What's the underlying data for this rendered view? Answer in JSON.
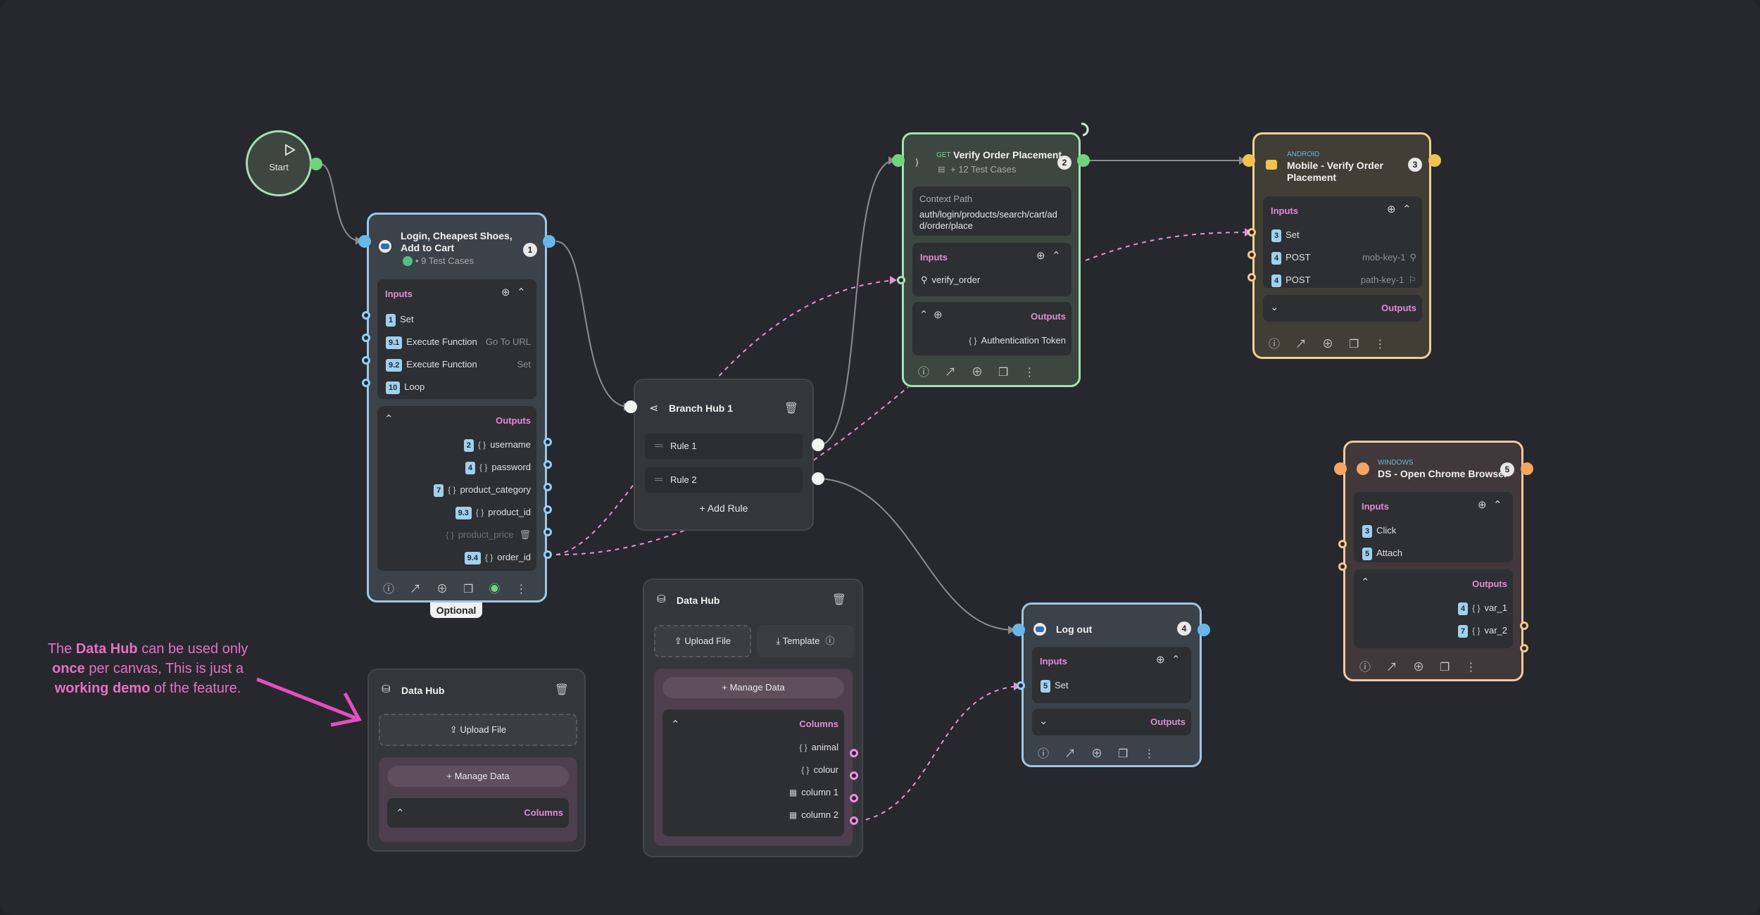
{
  "start": {
    "label": "Start"
  },
  "login_node": {
    "title": "Login, Cheapest Shoes, Add to Cart",
    "test_cases": "• 9 Test Cases",
    "number": "1",
    "inputs_title": "Inputs",
    "inputs": [
      {
        "badge": "1",
        "label": "Set",
        "value": ""
      },
      {
        "badge": "9.1",
        "label": "Execute Function",
        "value": "Go To URL"
      },
      {
        "badge": "9.2",
        "label": "Execute Function",
        "value": "Set"
      },
      {
        "badge": "10",
        "label": "Loop",
        "value": ""
      }
    ],
    "outputs_title": "Outputs",
    "outputs": [
      {
        "badge": "2",
        "label": "username"
      },
      {
        "badge": "4",
        "label": "password"
      },
      {
        "badge": "7",
        "label": "product_category"
      },
      {
        "badge": "9.3",
        "label": "product_id"
      },
      {
        "badge": "",
        "label": "product_price"
      },
      {
        "badge": "9.4",
        "label": "order_id"
      }
    ],
    "optional_label": "Optional"
  },
  "branch_hub": {
    "title": "Branch Hub 1",
    "rules": [
      "Rule 1",
      "Rule 2"
    ],
    "add_rule": "Add Rule"
  },
  "verify_node": {
    "method": "GET",
    "title": "Verify Order Placement",
    "test_cases": "+ 12 Test Cases",
    "number": "2",
    "context_label": "Context Path",
    "context_value": "auth/login/products/search/cart/add/order/place",
    "inputs_title": "Inputs",
    "input_item": "verify_order",
    "outputs_title": "Outputs",
    "output_item": "Authentication Token"
  },
  "mobile_node": {
    "platform": "ANDROID",
    "title": "Mobile - Verify Order Placement",
    "number": "3",
    "inputs_title": "Inputs",
    "inputs": [
      {
        "badge": "3",
        "label": "Set",
        "value": ""
      },
      {
        "badge": "4",
        "label": "POST",
        "value": "mob-key-1"
      },
      {
        "badge": "4",
        "label": "POST",
        "value": "path-key-1"
      }
    ],
    "outputs_title": "Outputs"
  },
  "windows_node": {
    "platform": "WINDOWS",
    "title": "DS - Open Chrome Browser",
    "number": "5",
    "inputs_title": "Inputs",
    "inputs": [
      {
        "badge": "3",
        "label": "Click"
      },
      {
        "badge": "5",
        "label": "Attach"
      }
    ],
    "outputs_title": "Outputs",
    "outputs": [
      {
        "badge": "4",
        "label": "var_1"
      },
      {
        "badge": "7",
        "label": "var_2"
      }
    ]
  },
  "logout_node": {
    "title": "Log out",
    "number": "4",
    "inputs_title": "Inputs",
    "input_badge": "5",
    "input_label": "Set",
    "outputs_title": "Outputs"
  },
  "datahub_small": {
    "title": "Data Hub",
    "upload": "Upload File",
    "manage": "Manage Data",
    "columns_title": "Columns"
  },
  "datahub_large": {
    "title": "Data Hub",
    "upload": "Upload File",
    "template": "Template",
    "manage": "Manage Data",
    "columns_title": "Columns",
    "columns": [
      "animal",
      "colour",
      "column 1",
      "column 2"
    ]
  },
  "annotation": {
    "p1": "The ",
    "b1": "Data Hub",
    "p2": " can be used only",
    "b2": "once",
    "p3": " per canvas, This is just a",
    "b3": "working demo",
    "p4": " of the feature."
  },
  "colors": {
    "accent_pink": "#e58ad8",
    "port_blue": "#6ab6e8",
    "port_green": "#6ed47c",
    "port_yellow": "#f2c14e",
    "port_orange": "#f4a561"
  }
}
